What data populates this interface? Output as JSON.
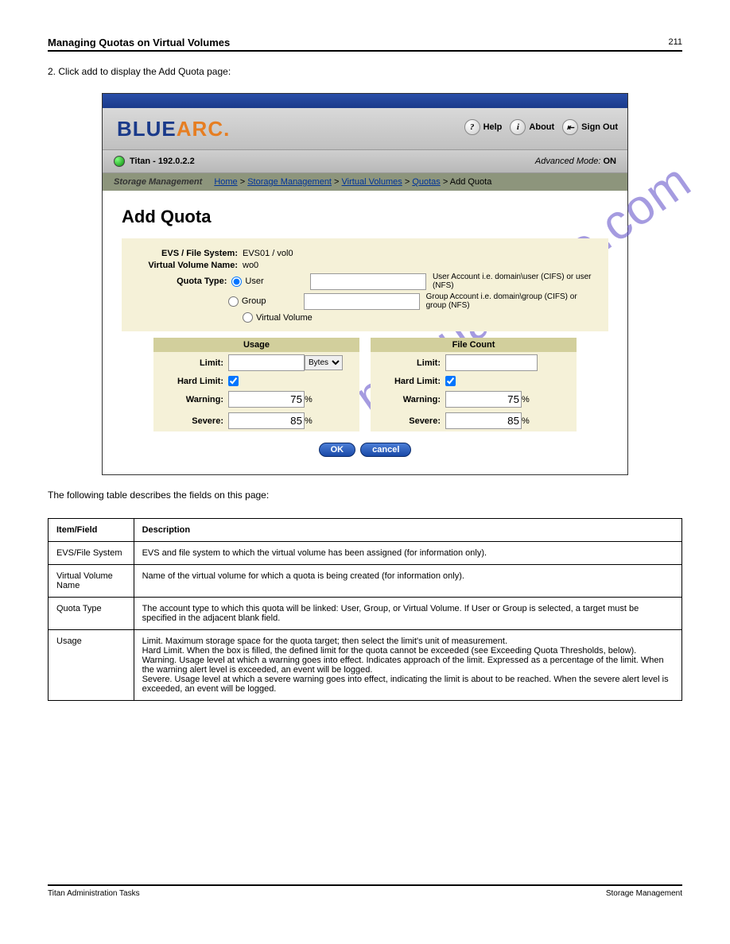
{
  "page_header": "Managing Quotas on Virtual Volumes",
  "page_number": "211",
  "section_intro": "2. Click add to display the Add Quota page:",
  "watermark": "manualshive.com",
  "app": {
    "logo": {
      "blue": "BLUE",
      "arc": "ARC",
      "dot": "."
    },
    "help_label": "Help",
    "about_label": "About",
    "signout_label": "Sign Out",
    "status_host": "Titan - 192.0.2.2",
    "adv_mode_label": "Advanced Mode:",
    "adv_mode_value": "ON",
    "breadcrumb_section": "Storage Management",
    "breadcrumb": {
      "home": "Home",
      "storage_mgmt": "Storage Management",
      "virtual_volumes": "Virtual Volumes",
      "quotas": "Quotas",
      "current": "Add Quota"
    },
    "title": "Add Quota",
    "evs_label": "EVS / File System:",
    "evs_value": "EVS01 / vol0",
    "vv_label": "Virtual Volume Name:",
    "vv_value": "wo0",
    "quota_type_label": "Quota Type:",
    "user_label": "User",
    "user_hint": "User Account i.e. domain\\user (CIFS) or user (NFS)",
    "group_label": "Group",
    "group_hint": "Group Account i.e. domain\\group (CIFS) or group (NFS)",
    "vv_radio_label": "Virtual Volume",
    "usage_header": "Usage",
    "filecount_header": "File Count",
    "limit_label": "Limit:",
    "hard_limit_label": "Hard Limit:",
    "warning_label": "Warning:",
    "severe_label": "Severe:",
    "warning_value": "75",
    "severe_value": "85",
    "unit_select": "Bytes",
    "percent": "%",
    "ok_label": "OK",
    "cancel_label": "cancel"
  },
  "table_caption": "The following table describes the fields on this page:",
  "table": {
    "h1": "Item/Field",
    "h2": "Description",
    "rows": [
      {
        "f": "EVS/File System",
        "d": "EVS and file system to which the virtual volume has been assigned (for information only)."
      },
      {
        "f": "Virtual Volume Name",
        "d": "Name of the virtual volume for which a quota is being created (for information only)."
      },
      {
        "f": "Quota Type",
        "d": "The account type to which this quota will be linked: User, Group, or Virtual Volume. If User or Group is selected, a target must be specified in the adjacent blank field."
      },
      {
        "f": "Usage",
        "d": "Limit. Maximum storage space for the quota target; then select the limit's unit of measurement.\nHard Limit. When the box is filled, the defined limit for the quota cannot be exceeded (see Exceeding Quota Thresholds, below).\nWarning. Usage level at which a warning goes into effect. Indicates approach of the limit. Expressed as a percentage of the limit. When the warning alert level is exceeded, an event will be logged.\nSevere. Usage level at which a severe warning goes into effect, indicating the limit is about to be reached. When the severe alert level is exceeded, an event will be logged."
      }
    ]
  },
  "footer": {
    "left": "Titan Administration Tasks",
    "right": "Storage Management"
  }
}
